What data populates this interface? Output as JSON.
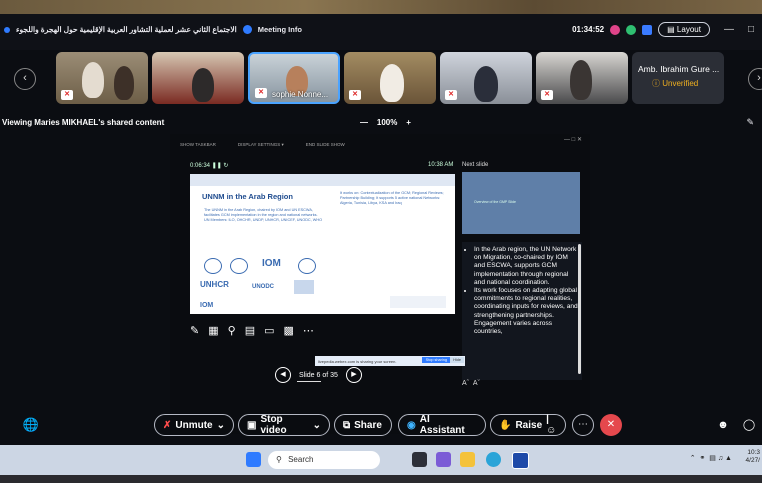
{
  "window": {
    "title": "الاجتماع الثاني عشر لعملية التشاور العربية الإقليمية حول الهجرة واللجوء",
    "meeting_info": "Meeting Info",
    "timer": "01:34:52",
    "layout_label": "Layout"
  },
  "participants": [
    {
      "name": ""
    },
    {
      "name": ""
    },
    {
      "name": "sophie Nonne..."
    },
    {
      "name": ""
    },
    {
      "name": ""
    },
    {
      "name": ""
    }
  ],
  "amb_tile": {
    "name": "Amb. Ibrahim Gure ...",
    "status": "Unverified"
  },
  "share_bar": {
    "label": "Viewing Maries MIKHAEL's shared content",
    "zoom": "100%"
  },
  "presenter": {
    "controls": [
      "SHOW TASKBAR",
      "DISPLAY SETTINGS ▾",
      "END SLIDE SHOW"
    ],
    "elapsed": "0:06:34",
    "clock": "10:38 AM",
    "next_slide_label": "Next slide",
    "next_thumb_text": "Overview of the GMP Slide",
    "slide_indicator": "Slide 6 of 35",
    "share_notice": "livepedia.webex.com is sharing your screen.",
    "stop_sharing": "Stop sharing",
    "hide": "Hide"
  },
  "slide": {
    "title": "UNNM in the Arab Region",
    "left_body": "The UNNM in the Arab Region, chaired by IOM and UN ESCWA, facilitates GCM implementation in the region and national networks. UN Members: ILO, OHCHR, UNDP, UNHCR, UNICEF, UNODC, WHO",
    "right_body": "It works on: Contextualization of the GCM; Regional Reviews; Partnership Building; It supports 5 active national Networks: Algeria, Tunisia, Libya, KSA and Iraq",
    "logos": [
      "IOM",
      "UNHCR",
      "UNODC",
      "IOM"
    ]
  },
  "notes": [
    "In the Arab region, the UN Network on Migration, co-chaired by IOM and ESCWA, supports GCM implementation through regional and national coordination.",
    "Its work focuses on adapting global commitments to regional realities, coordinating inputs for reviews, and strengthening partnerships. Engagement varies across countries,"
  ],
  "controls": {
    "unmute": "Unmute",
    "stop_video": "Stop video",
    "share": "Share",
    "ai_assistant": "AI Assistant",
    "raise": "Raise"
  },
  "taskbar": {
    "search_placeholder": "Search",
    "time": "10:3",
    "date": "4/27/"
  },
  "colors": {
    "accent": "#2f7bff",
    "leave": "#e5484d",
    "warning": "#f0b020"
  }
}
